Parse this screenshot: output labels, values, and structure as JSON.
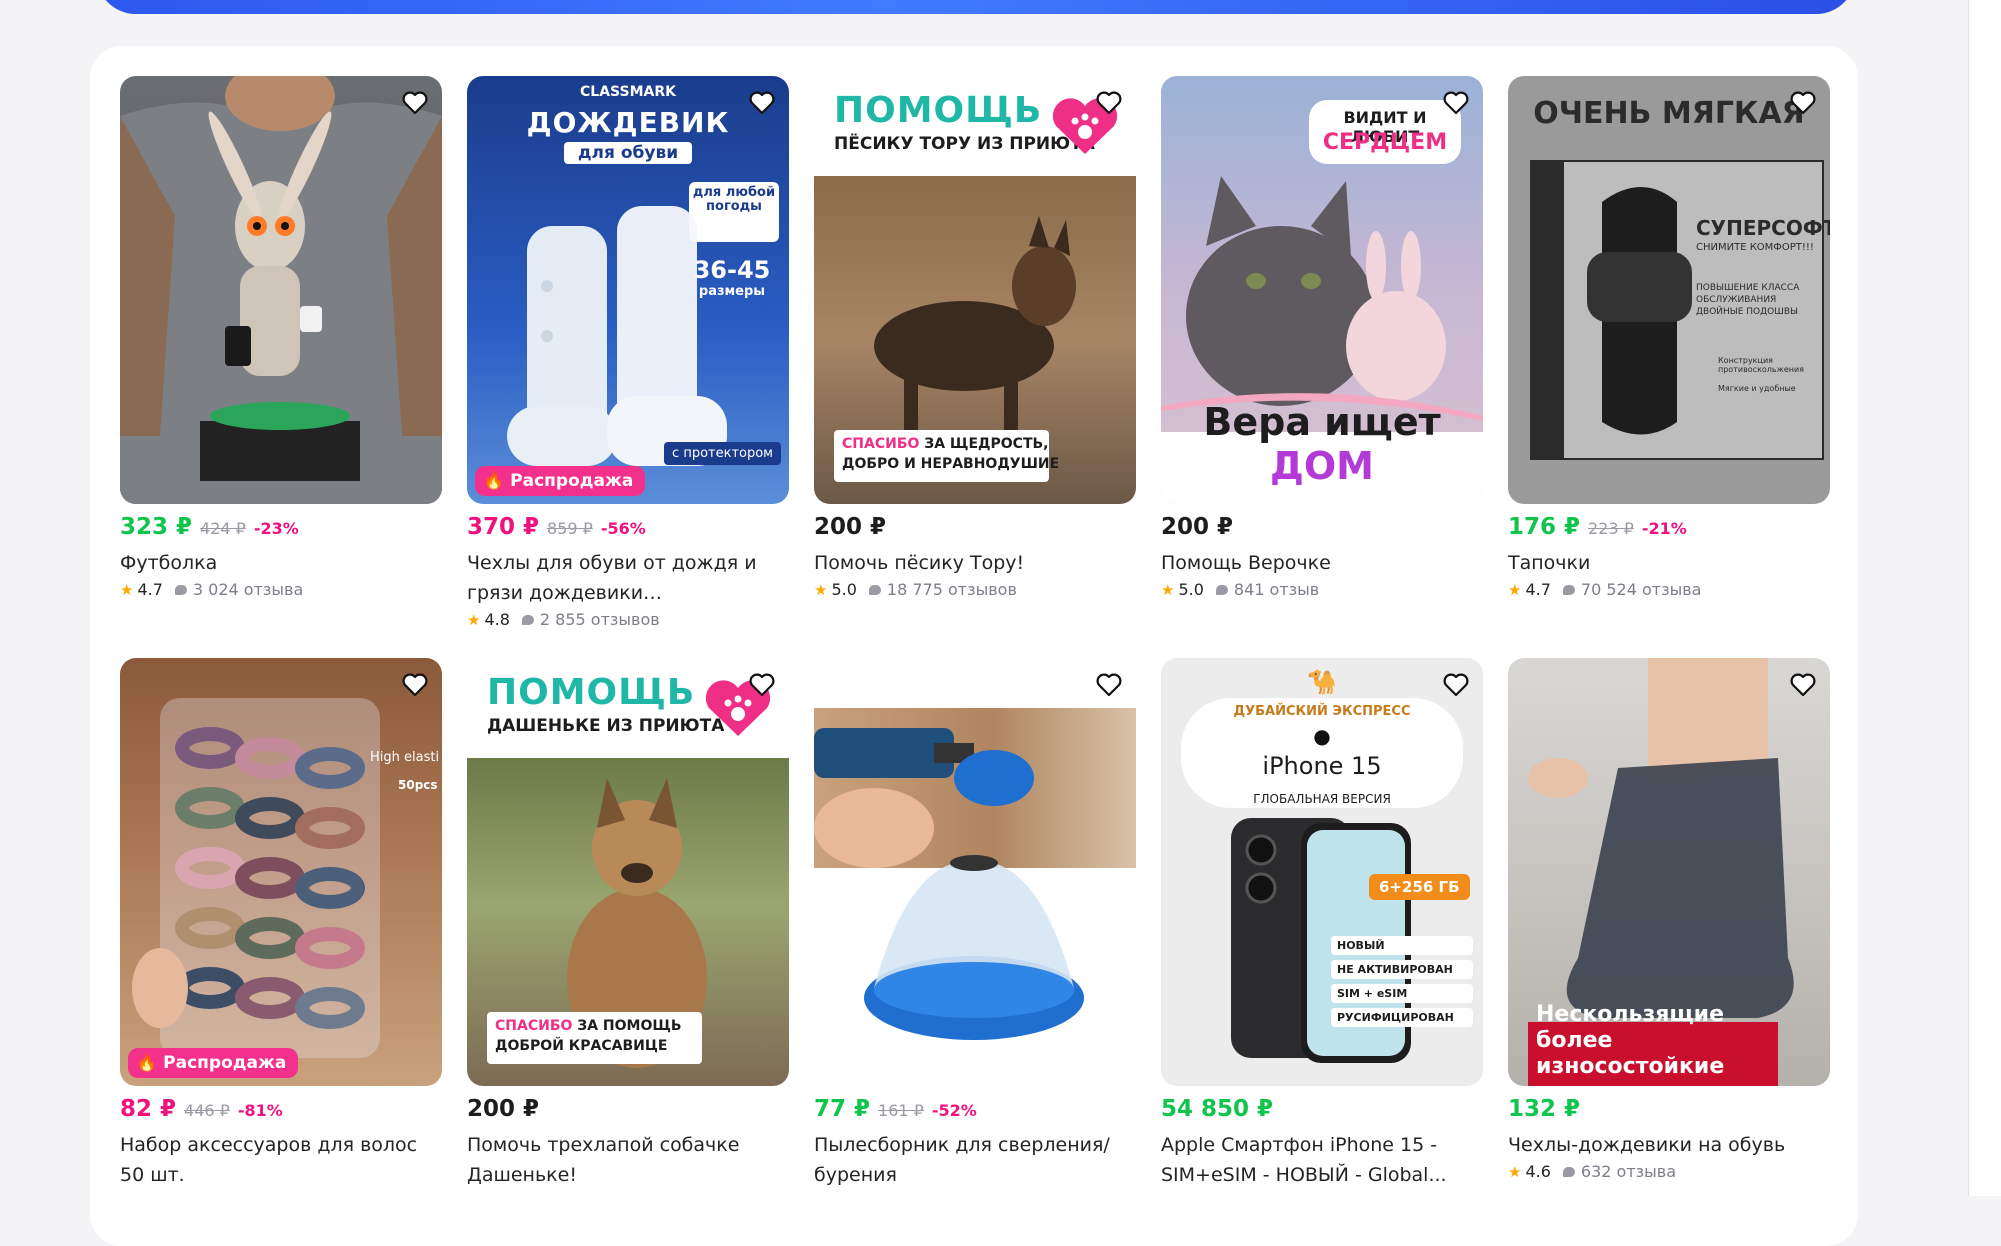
{
  "colors": {
    "price_green": "#10c44c",
    "price_pink": "#f1117e",
    "sale_badge": "#f3318d",
    "star": "#ffa800"
  },
  "icons": {
    "favorite": "heart-outline-icon",
    "sale": "flame-icon",
    "rating": "star-icon",
    "reviews": "speech-bubble-icon"
  },
  "products": [
    {
      "price": "323 ₽",
      "old_price": "424 ₽",
      "discount": "-23%",
      "name": "Футболка",
      "rating": "4.7",
      "reviews": "3 024 отзыва"
    },
    {
      "price": "370 ₽",
      "old_price": "859 ₽",
      "discount": "-56%",
      "name": "Чехлы для обуви от дождя и грязи дождевики многоразовы...",
      "rating": "4.8",
      "reviews": "2 855 отзывов",
      "badge": "Распродажа",
      "img_text": {
        "brand": "CLASSMARK",
        "title": "ДОЖДЕВИК",
        "subtitle": "для обуви",
        "weather": "для любой погоды",
        "sizes": "36-45",
        "sizes_label": "размеры",
        "feature": "с протектором"
      }
    },
    {
      "price": "200 ₽",
      "name": "Помочь пёсику Тору!",
      "rating": "5.0",
      "reviews": "18 775 отзывов",
      "img_text": {
        "title": "ПОМОЩЬ",
        "subtitle": "ПЁСИКУ ТОРУ ИЗ ПРИЮТА",
        "thanks_accent": "СПАСИБО",
        "thanks_rest1": "ЗА ЩЕДРОСТЬ,",
        "thanks_rest2": "ДОБРО И НЕРАВНОДУШИЕ"
      }
    },
    {
      "price": "200 ₽",
      "name": "Помощь Верочке",
      "rating": "5.0",
      "reviews": "841 отзыв",
      "img_text": {
        "line1": "ВИДИТ И ЛЮБИТ",
        "line2": "СЕРДЦЕМ",
        "bottom_a": "Вера ищет",
        "bottom_b": "ДОМ"
      }
    },
    {
      "price": "176 ₽",
      "old_price": "223 ₽",
      "discount": "-21%",
      "name": "Тапочки",
      "rating": "4.7",
      "reviews": "70 524 отзыва",
      "img_text": {
        "title": "ОЧЕНЬ МЯГКАЯ",
        "brand": "СУПЕРСОФТ",
        "tagline": "СНИМИТЕ КОМФОРТ!!!",
        "feat1": "ПОВЫШЕНИЕ КЛАССА ОБСЛУЖИВАНИЯ ДВОЙНЫЕ ПОДОШВЫ",
        "feat2": "Конструкция противоскольжения",
        "feat3": "Мягкие и удобные"
      }
    },
    {
      "price": "82 ₽",
      "old_price": "446 ₽",
      "discount": "-81%",
      "name": "Набор аксессуаров для волос 50 шт.",
      "badge": "Распродажа",
      "img_text": {
        "l1": "High elasti",
        "l2": "50pcs"
      }
    },
    {
      "price": "200 ₽",
      "name": "Помочь трехлапой собачке Дашеньке!",
      "img_text": {
        "title": "ПОМОЩЬ",
        "subtitle": "ДАШЕНЬКЕ ИЗ ПРИЮТА",
        "thanks_accent": "СПАСИБО",
        "thanks_rest1": "ЗА ПОМОЩЬ",
        "thanks_rest2": "ДОБРОЙ КРАСАВИЦЕ"
      }
    },
    {
      "price": "77 ₽",
      "old_price": "161 ₽",
      "discount": "-52%",
      "name": "Пылесборник для сверления/ бурения"
    },
    {
      "price": "54 850 ₽",
      "name": "Apple Смартфон iPhone 15 - SIM+eSIM - НОВЫЙ - Global...",
      "img_text": {
        "shop": "ДУБАЙСКИЙ ЭКСПРЕСС",
        "model": "iPhone 15",
        "version": "ГЛОБАЛЬНАЯ ВЕРСИЯ",
        "memory": "6+256 ГБ",
        "f1": "НОВЫЙ",
        "f2": "НЕ АКТИВИРОВАН",
        "f3": "SIM + eSIM",
        "f4": "РУСИФИЦИРОВАН"
      }
    },
    {
      "price": "132 ₽",
      "name": "Чехлы-дождевики на обувь",
      "rating": "4.6",
      "reviews": "632 отзыва",
      "img_text": {
        "banner": "Нескользящие более износостойкие"
      }
    }
  ]
}
